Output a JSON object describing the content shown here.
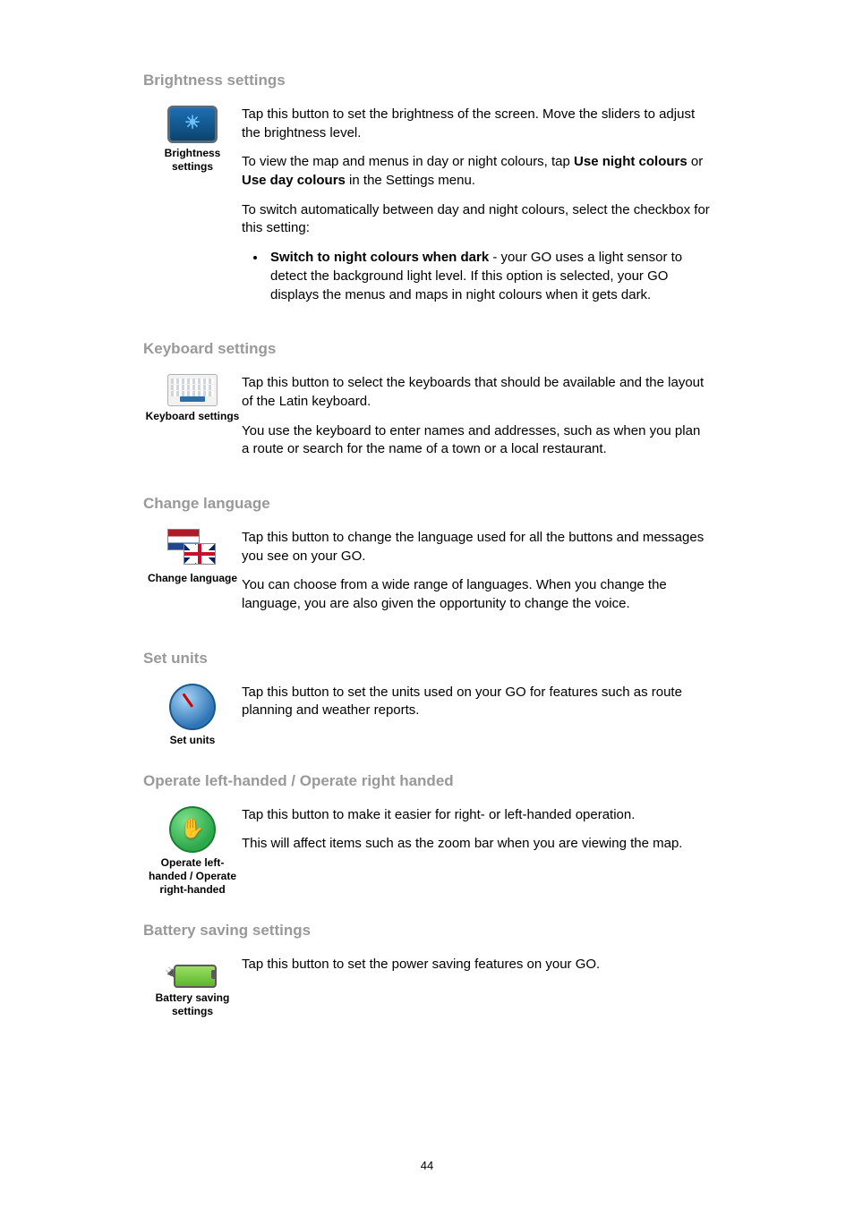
{
  "page_number": "44",
  "sections": {
    "brightness": {
      "title": "Brightness settings",
      "icon_label": "Brightness settings",
      "p1": "Tap this button to set the brightness of the screen. Move the sliders to adjust the brightness level.",
      "p2a": "To view the map and menus in day or night colours, tap ",
      "p2b_bold": "Use night colours",
      "p2c": " or ",
      "p2d_bold": "Use day colours",
      "p2e": " in the Settings menu.",
      "p3": "To switch automatically between day and night colours, select the checkbox for this setting:",
      "bullet_bold": "Switch to night colours when dark",
      "bullet_rest": " - your GO uses a light sensor to detect the background light level. If this option is selected, your GO displays the menus and maps in night colours when it gets dark."
    },
    "keyboard": {
      "title": "Keyboard settings",
      "icon_label": "Keyboard settings",
      "p1": "Tap this button to select the keyboards that should be available and the layout of the Latin keyboard.",
      "p2": "You use the keyboard to enter names and addresses, such as when you plan a route or search for the name of a town or a local restaurant."
    },
    "language": {
      "title": "Change language",
      "icon_label": "Change language",
      "p1": "Tap this button to change the language used for all the buttons and messages you see on your GO.",
      "p2": "You can choose from a wide range of languages. When you change the language, you are also given the opportunity to change the voice."
    },
    "units": {
      "title": "Set units",
      "icon_label": "Set units",
      "p1": "Tap this button to set the units used on your GO for features such as route planning and weather reports."
    },
    "handed": {
      "title": "Operate left-handed / Operate right handed",
      "icon_label": "Operate left-handed / Operate right-handed",
      "p1": "Tap this button to make it easier for right- or left-handed operation.",
      "p2": "This will affect items such as the zoom bar when you are viewing the map."
    },
    "battery": {
      "title": "Battery saving settings",
      "icon_label": "Battery saving settings",
      "p1": "Tap this button to set the power saving features on your GO."
    }
  }
}
